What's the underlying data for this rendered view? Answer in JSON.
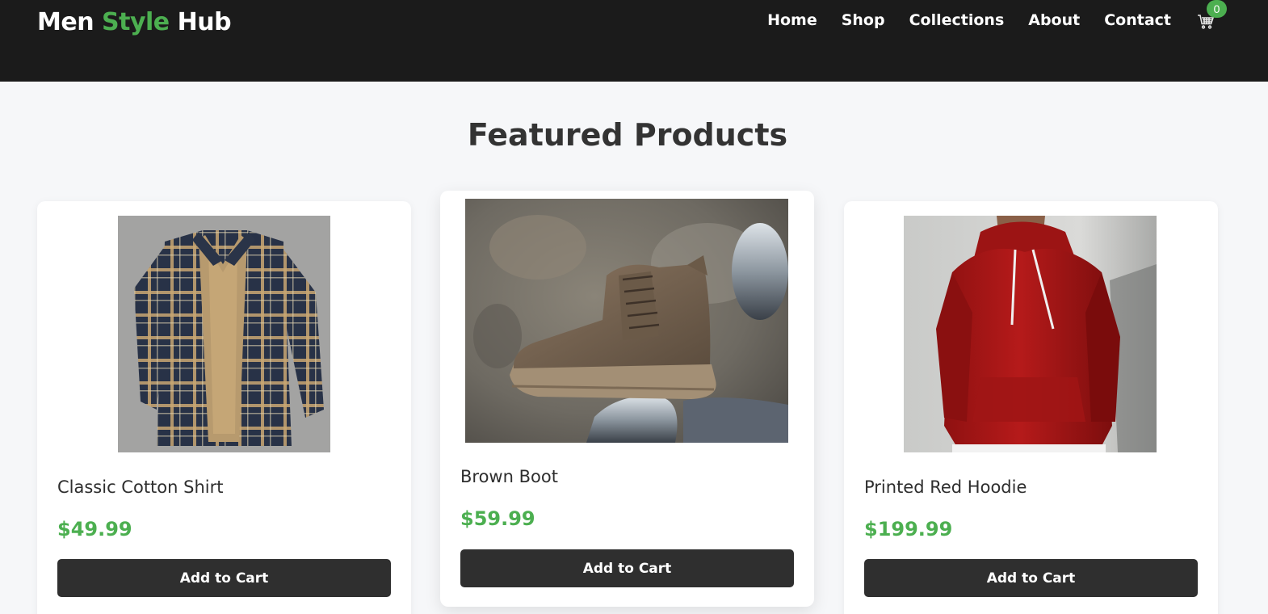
{
  "brand": {
    "part1": "Men ",
    "accent": "Style",
    "part2": " Hub",
    "accent_color": "#4caf50"
  },
  "nav": {
    "items": [
      "Home",
      "Shop",
      "Collections",
      "About",
      "Contact"
    ]
  },
  "cart": {
    "icon": "shopping-cart-icon",
    "count": "0"
  },
  "section": {
    "title": "Featured Products"
  },
  "products": [
    {
      "name": "Classic Cotton Shirt",
      "price": "$49.99",
      "button": "Add to Cart",
      "image": "plaid-flannel-shirt"
    },
    {
      "name": "Brown Boot",
      "price": "$59.99",
      "button": "Add to Cart",
      "image": "brown-suede-boot"
    },
    {
      "name": "Printed Red Hoodie",
      "price": "$199.99",
      "button": "Add to Cart",
      "image": "red-hoodie"
    }
  ],
  "colors": {
    "header_bg": "#1b1b1b",
    "page_bg": "#f6f7f9",
    "price": "#4caf50",
    "button_bg": "#2f2f2f"
  }
}
